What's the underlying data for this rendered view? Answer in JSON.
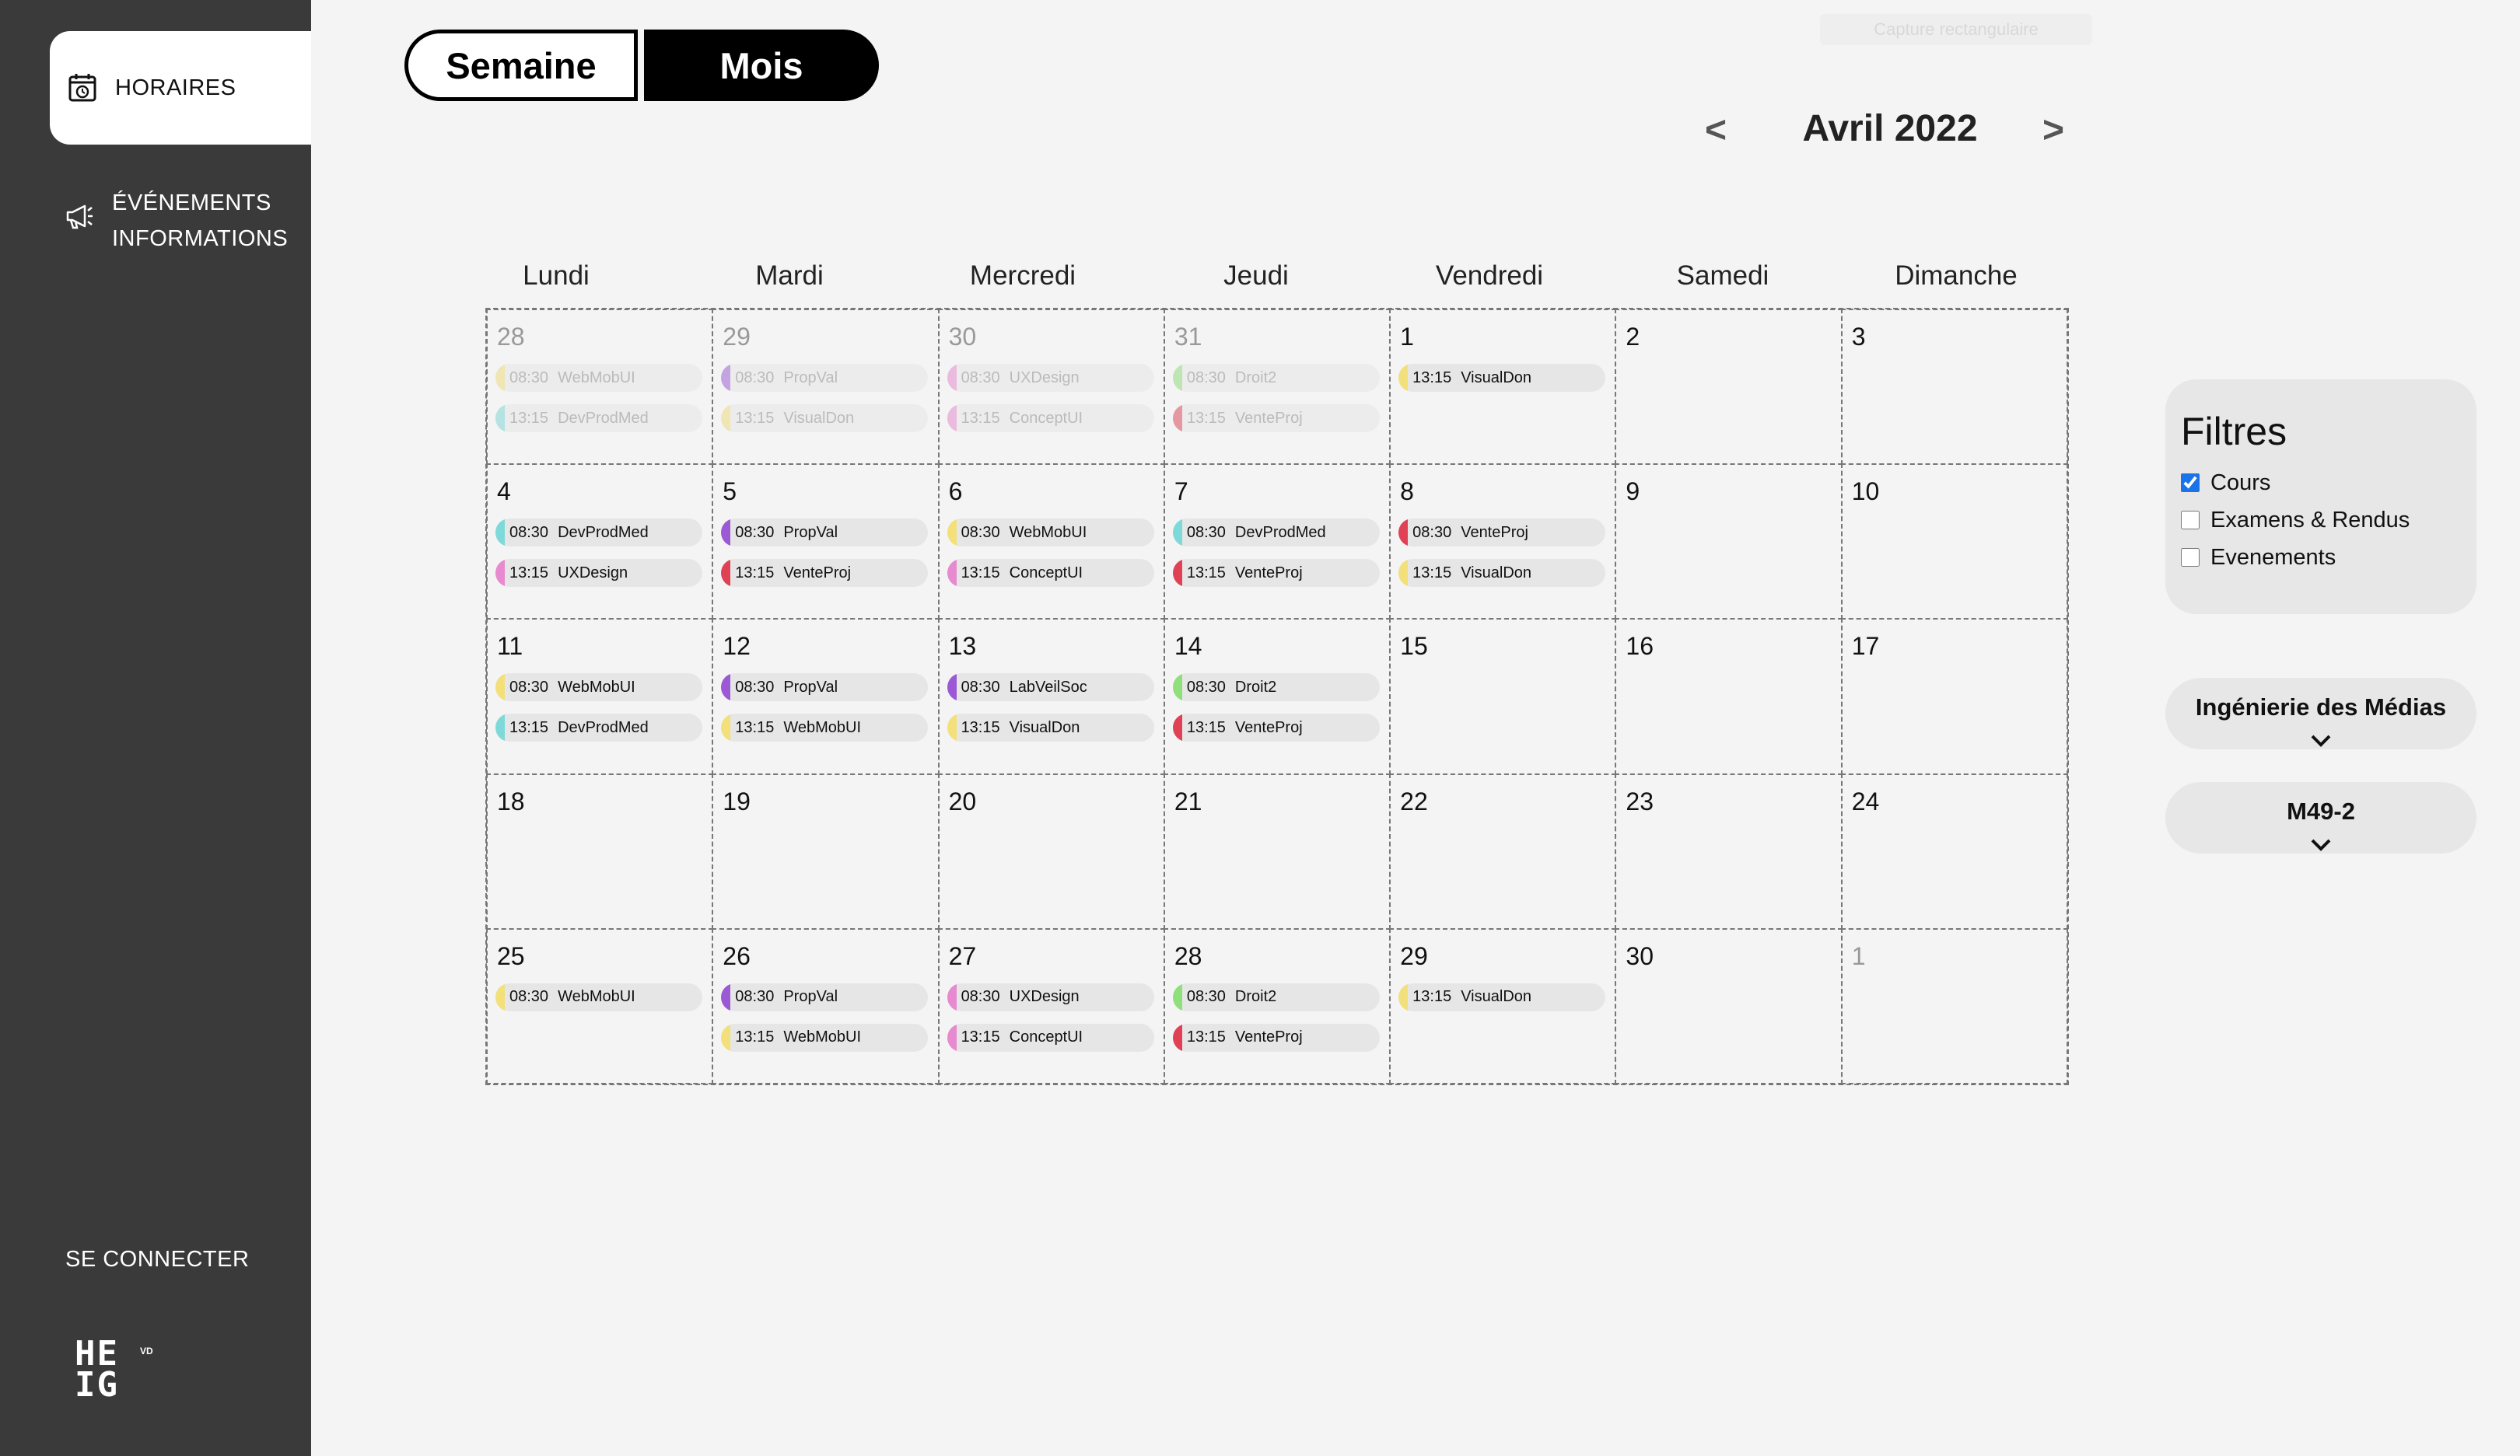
{
  "sidebar": {
    "schedule_label": "HORAIRES",
    "events_line1": "ÉVÉNEMENTS",
    "events_line2": "INFORMATIONS",
    "login_label": "SE CONNECTER",
    "logo_line1": "HE",
    "logo_line2": "IG",
    "logo_vd": "VD"
  },
  "view": {
    "week_label": "Semaine",
    "month_label": "Mois",
    "active": "month"
  },
  "ghost_label": "Capture rectangulaire",
  "month": {
    "prev": "<",
    "title": "Avril 2022",
    "next": ">"
  },
  "weekdays": [
    "Lundi",
    "Mardi",
    "Mercredi",
    "Jeudi",
    "Vendredi",
    "Samedi",
    "Dimanche"
  ],
  "colors": {
    "yellow": "#f3e07a",
    "purple": "#9b59d6",
    "cyan": "#7ed9d9",
    "green": "#8fe07a",
    "red": "#e04155",
    "pink": "#e88ad0"
  },
  "weeks": [
    [
      {
        "day": "28",
        "muted": true,
        "events": [
          {
            "time": "08:30",
            "title": "WebMobUI",
            "color": "yellow"
          },
          {
            "time": "13:15",
            "title": "DevProdMed",
            "color": "cyan"
          }
        ]
      },
      {
        "day": "29",
        "muted": true,
        "events": [
          {
            "time": "08:30",
            "title": "PropVal",
            "color": "purple"
          },
          {
            "time": "13:15",
            "title": "VisualDon",
            "color": "yellow"
          }
        ]
      },
      {
        "day": "30",
        "muted": true,
        "events": [
          {
            "time": "08:30",
            "title": "UXDesign",
            "color": "pink"
          },
          {
            "time": "13:15",
            "title": "ConceptUI",
            "color": "pink"
          }
        ]
      },
      {
        "day": "31",
        "muted": true,
        "events": [
          {
            "time": "08:30",
            "title": "Droit2",
            "color": "green"
          },
          {
            "time": "13:15",
            "title": "VenteProj",
            "color": "red"
          }
        ]
      },
      {
        "day": "1",
        "events": [
          {
            "time": "13:15",
            "title": "VisualDon",
            "color": "yellow"
          }
        ]
      },
      {
        "day": "2",
        "events": []
      },
      {
        "day": "3",
        "events": []
      }
    ],
    [
      {
        "day": "4",
        "events": [
          {
            "time": "08:30",
            "title": "DevProdMed",
            "color": "cyan"
          },
          {
            "time": "13:15",
            "title": "UXDesign",
            "color": "pink"
          }
        ]
      },
      {
        "day": "5",
        "events": [
          {
            "time": "08:30",
            "title": "PropVal",
            "color": "purple"
          },
          {
            "time": "13:15",
            "title": "VenteProj",
            "color": "red"
          }
        ]
      },
      {
        "day": "6",
        "events": [
          {
            "time": "08:30",
            "title": "WebMobUI",
            "color": "yellow"
          },
          {
            "time": "13:15",
            "title": "ConceptUI",
            "color": "pink"
          }
        ]
      },
      {
        "day": "7",
        "events": [
          {
            "time": "08:30",
            "title": "DevProdMed",
            "color": "cyan"
          },
          {
            "time": "13:15",
            "title": "VenteProj",
            "color": "red"
          }
        ]
      },
      {
        "day": "8",
        "events": [
          {
            "time": "08:30",
            "title": "VenteProj",
            "color": "red"
          },
          {
            "time": "13:15",
            "title": "VisualDon",
            "color": "yellow"
          }
        ]
      },
      {
        "day": "9",
        "events": []
      },
      {
        "day": "10",
        "events": []
      }
    ],
    [
      {
        "day": "11",
        "events": [
          {
            "time": "08:30",
            "title": "WebMobUI",
            "color": "yellow"
          },
          {
            "time": "13:15",
            "title": "DevProdMed",
            "color": "cyan"
          }
        ]
      },
      {
        "day": "12",
        "events": [
          {
            "time": "08:30",
            "title": "PropVal",
            "color": "purple"
          },
          {
            "time": "13:15",
            "title": "WebMobUI",
            "color": "yellow"
          }
        ]
      },
      {
        "day": "13",
        "events": [
          {
            "time": "08:30",
            "title": "LabVeilSoc",
            "color": "purple"
          },
          {
            "time": "13:15",
            "title": "VisualDon",
            "color": "yellow"
          }
        ]
      },
      {
        "day": "14",
        "events": [
          {
            "time": "08:30",
            "title": "Droit2",
            "color": "green"
          },
          {
            "time": "13:15",
            "title": "VenteProj",
            "color": "red"
          }
        ]
      },
      {
        "day": "15",
        "events": []
      },
      {
        "day": "16",
        "events": []
      },
      {
        "day": "17",
        "events": []
      }
    ],
    [
      {
        "day": "18",
        "events": []
      },
      {
        "day": "19",
        "events": []
      },
      {
        "day": "20",
        "events": []
      },
      {
        "day": "21",
        "events": []
      },
      {
        "day": "22",
        "events": []
      },
      {
        "day": "23",
        "events": []
      },
      {
        "day": "24",
        "events": []
      }
    ],
    [
      {
        "day": "25",
        "events": [
          {
            "time": "08:30",
            "title": "WebMobUI",
            "color": "yellow"
          }
        ]
      },
      {
        "day": "26",
        "events": [
          {
            "time": "08:30",
            "title": "PropVal",
            "color": "purple"
          },
          {
            "time": "13:15",
            "title": "WebMobUI",
            "color": "yellow"
          }
        ]
      },
      {
        "day": "27",
        "events": [
          {
            "time": "08:30",
            "title": "UXDesign",
            "color": "pink"
          },
          {
            "time": "13:15",
            "title": "ConceptUI",
            "color": "pink"
          }
        ]
      },
      {
        "day": "28",
        "events": [
          {
            "time": "08:30",
            "title": "Droit2",
            "color": "green"
          },
          {
            "time": "13:15",
            "title": "VenteProj",
            "color": "red"
          }
        ]
      },
      {
        "day": "29",
        "events": [
          {
            "time": "13:15",
            "title": "VisualDon",
            "color": "yellow"
          }
        ]
      },
      {
        "day": "30",
        "events": []
      },
      {
        "day": "1",
        "muted": true,
        "events": []
      }
    ]
  ],
  "filters": {
    "title": "Filtres",
    "items": [
      {
        "label": "Cours",
        "checked": true
      },
      {
        "label": "Examens & Rendus",
        "checked": false
      },
      {
        "label": "Evenements",
        "checked": false
      }
    ]
  },
  "dropdowns": {
    "department": "Ingénierie des Médias",
    "class": "M49-2"
  }
}
